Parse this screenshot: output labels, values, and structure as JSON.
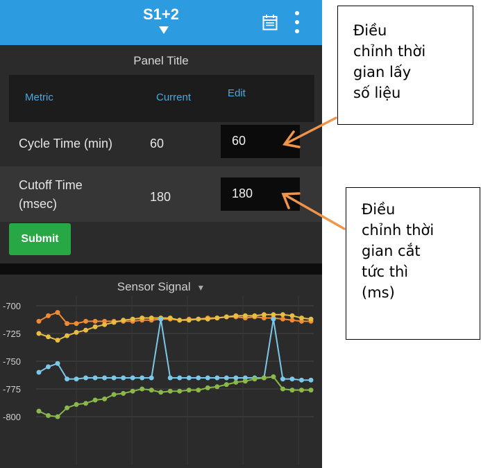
{
  "header": {
    "title": "S1+2"
  },
  "panel": {
    "title": "Panel Title",
    "columns": {
      "metric": "Metric",
      "current": "Current",
      "edit": "Edit"
    },
    "rows": [
      {
        "metric": "Cycle Time (min)",
        "current": "60",
        "edit": "60"
      },
      {
        "metric_line1": "Cutoff Time",
        "metric_line2": "(msec)",
        "current": "180",
        "edit": "180"
      }
    ],
    "submit": "Submit"
  },
  "chart": {
    "title": "Sensor Signal"
  },
  "chart_data": {
    "type": "line",
    "title": "Sensor Signal",
    "ylim": [
      -810,
      -695
    ],
    "yticks": [
      -700,
      -725,
      -750,
      -775,
      -800
    ],
    "x": [
      1,
      2,
      3,
      4,
      5,
      6,
      7,
      8,
      9,
      10,
      11,
      12,
      13,
      14,
      15,
      16,
      17,
      18,
      19,
      20,
      21,
      22,
      23,
      24,
      25,
      26,
      27,
      28,
      29,
      30
    ],
    "series": [
      {
        "color": "#f08a34",
        "values": [
          -714,
          -709,
          -706,
          -716,
          -716,
          -714,
          -714,
          -714,
          -714,
          -714,
          -714,
          -713,
          -713,
          -712,
          -712,
          -713,
          -712,
          -712,
          -711,
          -711,
          -710,
          -710,
          -711,
          -710,
          -711,
          -711,
          -712,
          -713,
          -714,
          -714
        ]
      },
      {
        "color": "#e8bd44",
        "values": [
          -725,
          -728,
          -731,
          -727,
          -724,
          -722,
          -719,
          -717,
          -715,
          -713,
          -712,
          -711,
          -711,
          -711,
          -711,
          -713,
          -713,
          -712,
          -712,
          -711,
          -710,
          -709,
          -709,
          -709,
          -708,
          -708,
          -708,
          -709,
          -711,
          -712
        ]
      },
      {
        "color": "#7cc8e8",
        "values": [
          -760,
          -755,
          -752,
          -766,
          -766,
          -765,
          -765,
          -765,
          -765,
          -765,
          -765,
          -765,
          -765,
          -712,
          -765,
          -765,
          -765,
          -765,
          -765,
          -765,
          -765,
          -765,
          -765,
          -765,
          -765,
          -712,
          -766,
          -766,
          -767,
          -767
        ]
      },
      {
        "color": "#8ab84a",
        "values": [
          -795,
          -799,
          -800,
          -792,
          -789,
          -788,
          -785,
          -784,
          -780,
          -779,
          -777,
          -775,
          -776,
          -778,
          -777,
          -777,
          -776,
          -776,
          -774,
          -773,
          -771,
          -769,
          -768,
          -766,
          -765,
          -764,
          -775,
          -776,
          -776,
          -776
        ]
      }
    ]
  },
  "annotations": [
    {
      "lines": [
        "Điều",
        "chỉnh thời",
        "gian lấy",
        "số liệu"
      ]
    },
    {
      "lines": [
        "Điều",
        "chỉnh thời",
        "gian cắt",
        "tức thì",
        "(ms)"
      ]
    }
  ],
  "colors": {
    "topbar": "#2d9be0",
    "accent": "#4aa8e0",
    "submit": "#27a844",
    "arrow": "#f0944a"
  },
  "icons": [
    "dropdown-caret-icon",
    "calendar-icon",
    "more-vertical-icon",
    "chevron-down-icon"
  ]
}
